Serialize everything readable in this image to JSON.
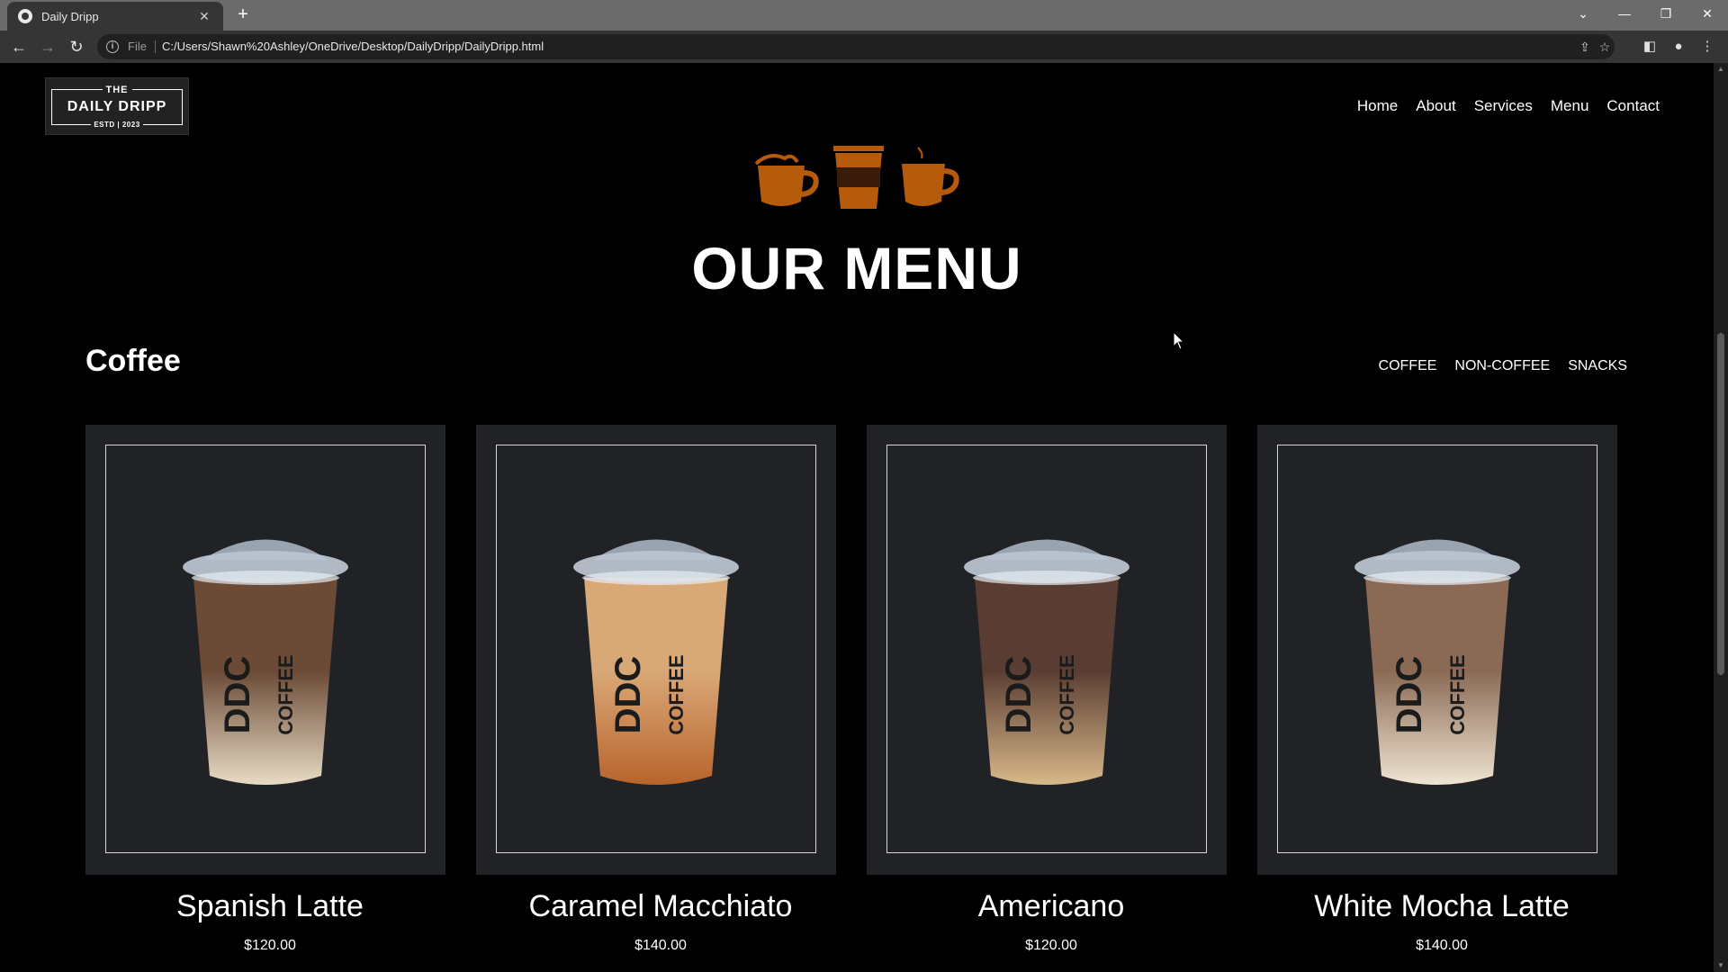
{
  "browser": {
    "tab_title": "Daily Dripp",
    "url_scheme": "File",
    "url": "C:/Users/Shawn%20Ashley/OneDrive/Desktop/DailyDripp/DailyDripp.html"
  },
  "logo": {
    "top": "THE",
    "name": "DAILY DRIPP",
    "estd": "ESTD | 2023"
  },
  "nav": [
    "Home",
    "About",
    "Services",
    "Menu",
    "Contact"
  ],
  "hero": {
    "title": "OUR MENU"
  },
  "section": {
    "title": "Coffee",
    "filters": [
      "COFFEE",
      "NON-COFFEE",
      "SNACKS"
    ]
  },
  "items": [
    {
      "name": "Spanish Latte",
      "price": "$120.00",
      "cup_label": "DDC",
      "cup_sub": "COFFEE",
      "top_color": "#6b4a36",
      "bottom_color": "#e8dcc4"
    },
    {
      "name": "Caramel Macchiato",
      "price": "$140.00",
      "cup_label": "DDC",
      "cup_sub": "COFFEE",
      "top_color": "#d9a877",
      "bottom_color": "#b8642c"
    },
    {
      "name": "Americano",
      "price": "$120.00",
      "cup_label": "DDC",
      "cup_sub": "COFFEE",
      "top_color": "#5a3d32",
      "bottom_color": "#d8b98a"
    },
    {
      "name": "White Mocha Latte",
      "price": "$140.00",
      "cup_label": "DDC",
      "cup_sub": "COFFEE",
      "top_color": "#8a6a55",
      "bottom_color": "#efe4d2"
    }
  ],
  "colors": {
    "accent_orange": "#b65a0c",
    "card_bg": "#212226",
    "page_bg": "#000000"
  }
}
